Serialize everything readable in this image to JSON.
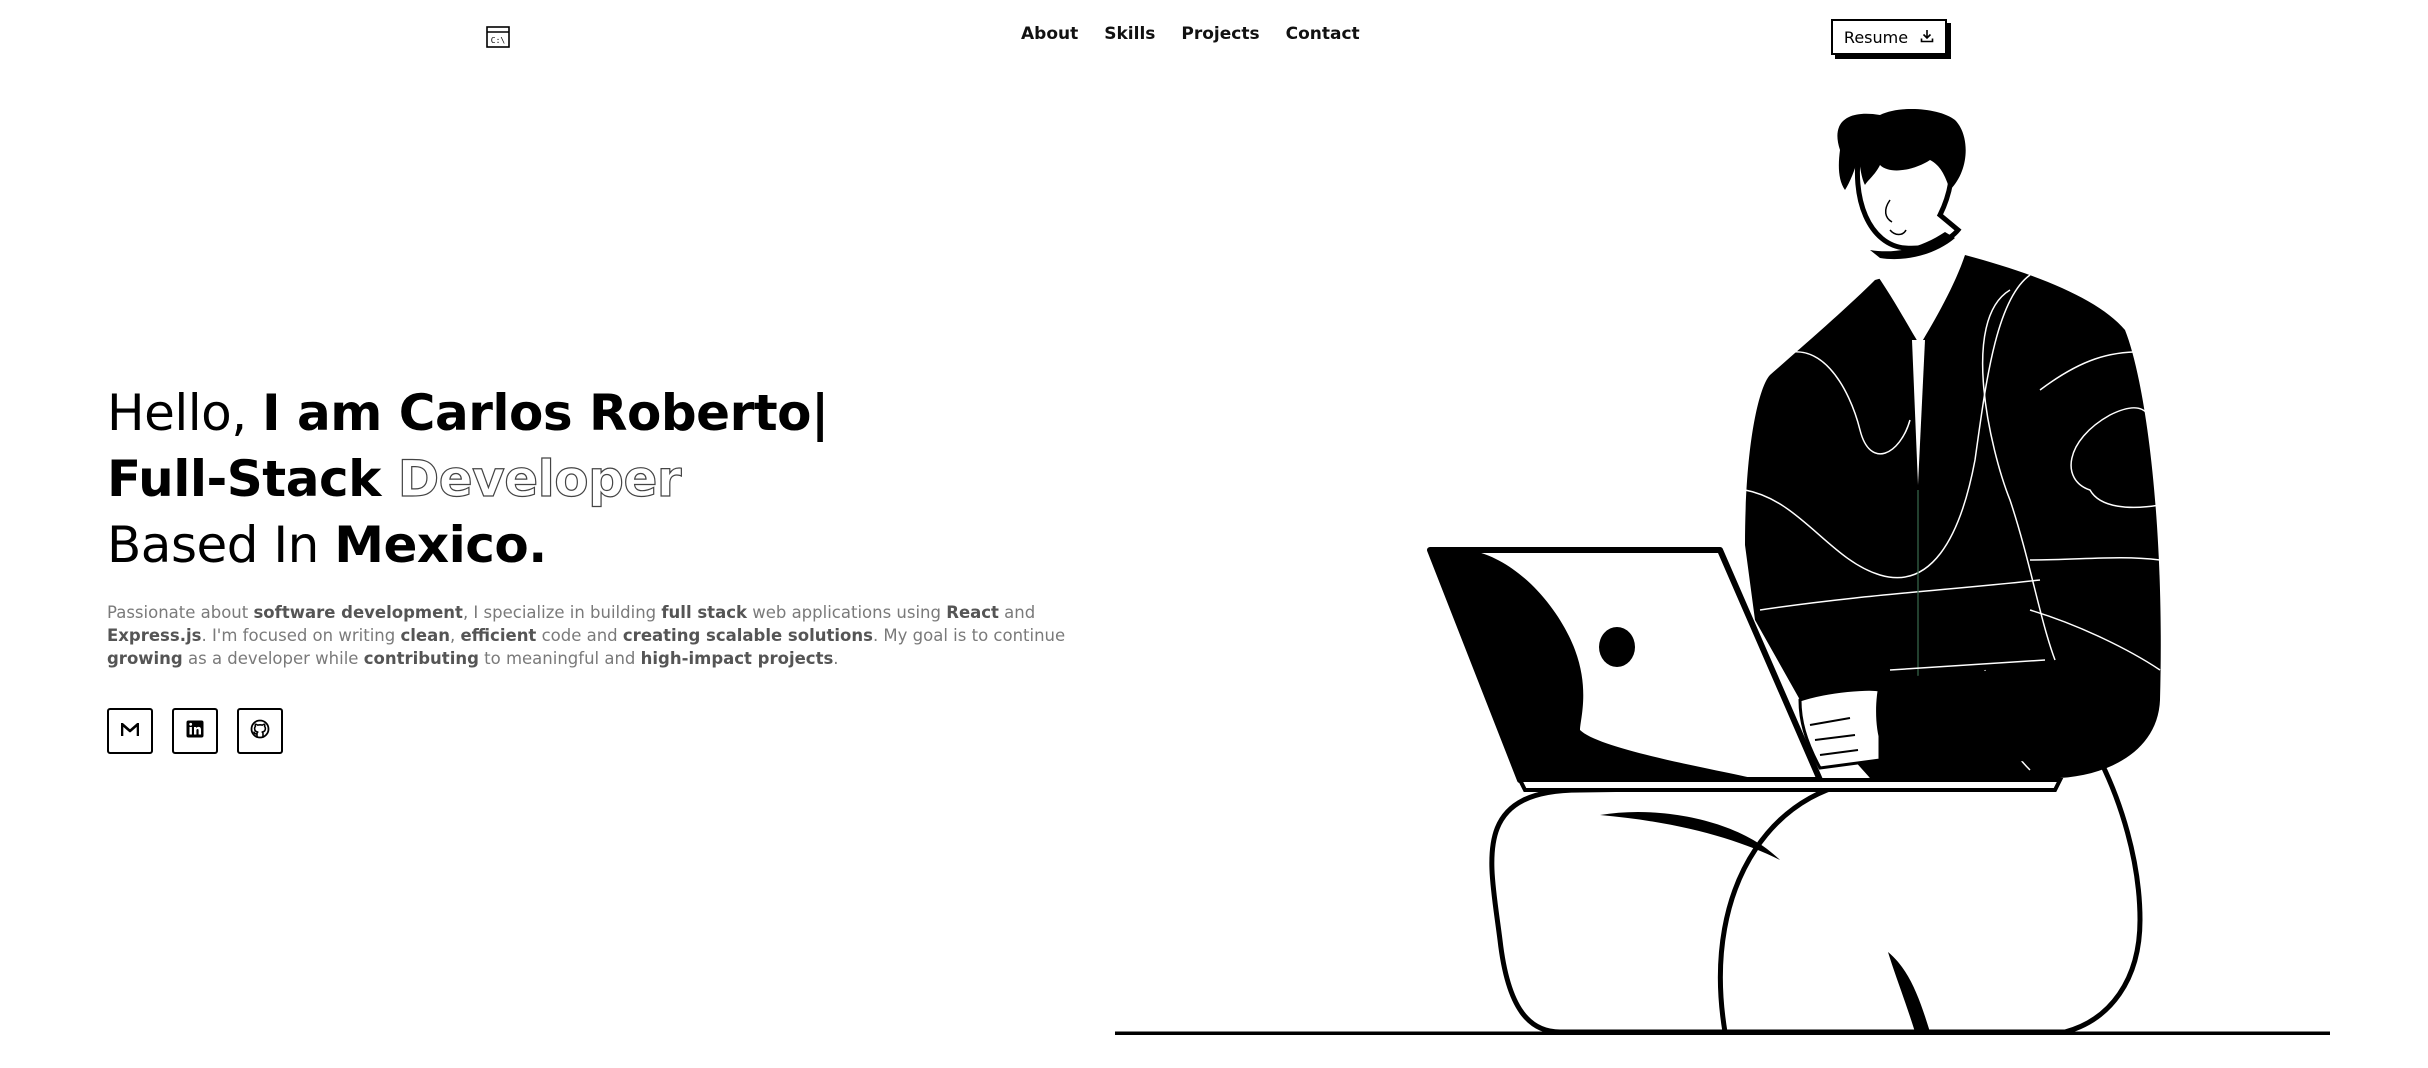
{
  "nav": {
    "logo_icon": "code-window-icon",
    "links": [
      "About",
      "Skills",
      "Projects",
      "Contact"
    ],
    "resume_label": "Resume",
    "resume_icon": "download-icon"
  },
  "hero": {
    "greeting": "Hello, ",
    "name": "I am Carlos Roberto|",
    "role_strong": "Full-Stack ",
    "role_outline": "Developer",
    "based_prefix": "Based In ",
    "location": "Mexico.",
    "description": [
      {
        "text": "Passionate about ",
        "strong": false
      },
      {
        "text": "software development",
        "strong": true
      },
      {
        "text": ", I specialize in building ",
        "strong": false
      },
      {
        "text": "full stack",
        "strong": true
      },
      {
        "text": " web applications using ",
        "strong": false
      },
      {
        "text": "React",
        "strong": true
      },
      {
        "text": " and ",
        "strong": false
      },
      {
        "text": "Express.js",
        "strong": true
      },
      {
        "text": ". I'm focused on writing ",
        "strong": false
      },
      {
        "text": "clean",
        "strong": true
      },
      {
        "text": ", ",
        "strong": false
      },
      {
        "text": "efficient",
        "strong": true
      },
      {
        "text": " code and ",
        "strong": false
      },
      {
        "text": "creating scalable solutions",
        "strong": true
      },
      {
        "text": ". My goal is to continue ",
        "strong": false
      },
      {
        "text": "growing",
        "strong": true
      },
      {
        "text": " as a developer while ",
        "strong": false
      },
      {
        "text": "contributing",
        "strong": true
      },
      {
        "text": " to meaningful and ",
        "strong": false
      },
      {
        "text": "high-impact projects",
        "strong": true
      },
      {
        "text": ".",
        "strong": false
      }
    ]
  },
  "socials": [
    {
      "icon": "gmail-icon"
    },
    {
      "icon": "linkedin-icon"
    },
    {
      "icon": "github-icon"
    }
  ],
  "illustration": {
    "icon": "person-with-laptop-illustration"
  },
  "colors": {
    "accent": "#000000",
    "text_muted": "#7a7a7a",
    "background": "#ffffff"
  }
}
